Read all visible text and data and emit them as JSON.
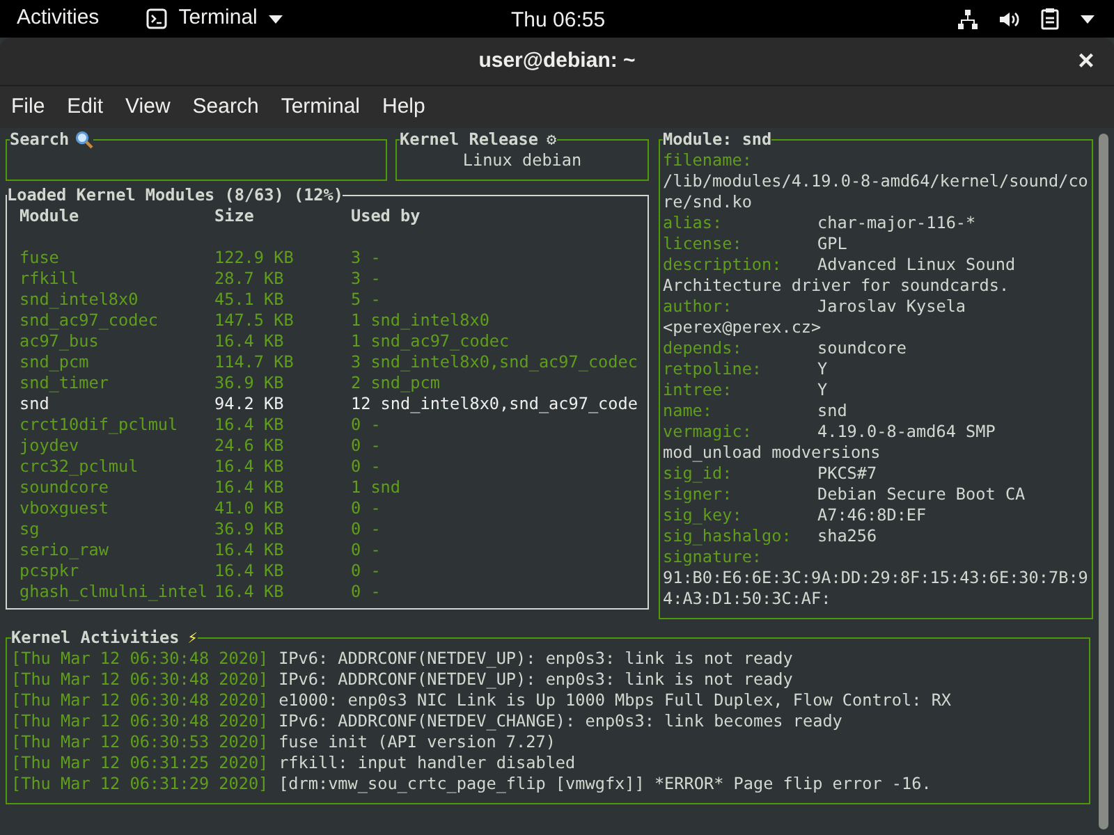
{
  "top_bar": {
    "activities": "Activities",
    "app_menu": "Terminal",
    "clock": "Thu 06:55"
  },
  "window": {
    "title": "user@debian: ~",
    "close": "×"
  },
  "menu": [
    "File",
    "Edit",
    "View",
    "Search",
    "Terminal",
    "Help"
  ],
  "search_panel": {
    "title": "Search",
    "focused": false
  },
  "kernel_release": {
    "title": "Kernel Release",
    "title_icon": "⚙",
    "value": "Linux debian"
  },
  "modules": {
    "title": "Loaded Kernel Modules (8/63) (12%)",
    "focused": true,
    "columns": [
      "Module",
      "Size",
      "Used by"
    ],
    "rows": [
      {
        "name": "fuse",
        "size": "122.9 KB",
        "used_by": "3 -",
        "selected": false
      },
      {
        "name": "rfkill",
        "size": "28.7 KB",
        "used_by": "3 -",
        "selected": false
      },
      {
        "name": "snd_intel8x0",
        "size": "45.1 KB",
        "used_by": "5 -",
        "selected": false
      },
      {
        "name": "snd_ac97_codec",
        "size": "147.5 KB",
        "used_by": "1 snd_intel8x0",
        "selected": false
      },
      {
        "name": "ac97_bus",
        "size": "16.4 KB",
        "used_by": "1 snd_ac97_codec",
        "selected": false
      },
      {
        "name": "snd_pcm",
        "size": "114.7 KB",
        "used_by": "3 snd_intel8x0,snd_ac97_codec",
        "selected": false
      },
      {
        "name": "snd_timer",
        "size": "36.9 KB",
        "used_by": "2 snd_pcm",
        "selected": false
      },
      {
        "name": "snd",
        "size": "94.2 KB",
        "used_by": "12 snd_intel8x0,snd_ac97_code",
        "selected": true
      },
      {
        "name": "crct10dif_pclmul",
        "size": "16.4 KB",
        "used_by": "0 -",
        "selected": false
      },
      {
        "name": "joydev",
        "size": "24.6 KB",
        "used_by": "0 -",
        "selected": false
      },
      {
        "name": "crc32_pclmul",
        "size": "16.4 KB",
        "used_by": "0 -",
        "selected": false
      },
      {
        "name": "soundcore",
        "size": "16.4 KB",
        "used_by": "1 snd",
        "selected": false
      },
      {
        "name": "vboxguest",
        "size": "41.0 KB",
        "used_by": "0 -",
        "selected": false
      },
      {
        "name": "sg",
        "size": "36.9 KB",
        "used_by": "0 -",
        "selected": false
      },
      {
        "name": "serio_raw",
        "size": "16.4 KB",
        "used_by": "0 -",
        "selected": false
      },
      {
        "name": "pcspkr",
        "size": "16.4 KB",
        "used_by": "0 -",
        "selected": false
      },
      {
        "name": "ghash_clmulni_intel",
        "size": "16.4 KB",
        "used_by": "0 -",
        "selected": false
      }
    ]
  },
  "module_info": {
    "title": "Module: snd",
    "focused": false,
    "fields": [
      {
        "label": "filename:",
        "inline": false,
        "value": [
          "/lib/modules/4.19.0-8-amd64/kernel/sound/co",
          "re/snd.ko"
        ]
      },
      {
        "label": "alias:",
        "inline": true,
        "value": [
          "char-major-116-*"
        ]
      },
      {
        "label": "license:",
        "inline": true,
        "value": [
          "GPL"
        ]
      },
      {
        "label": "description:",
        "inline": true,
        "value": [
          "Advanced Linux Sound",
          "Architecture driver for soundcards."
        ]
      },
      {
        "label": "author:",
        "inline": true,
        "value": [
          "Jaroslav Kysela",
          "<perex@perex.cz>"
        ]
      },
      {
        "label": "depends:",
        "inline": true,
        "value": [
          "soundcore"
        ]
      },
      {
        "label": "retpoline:",
        "inline": true,
        "value": [
          "Y"
        ]
      },
      {
        "label": "intree:",
        "inline": true,
        "value": [
          "Y"
        ]
      },
      {
        "label": "name:",
        "inline": true,
        "value": [
          "snd"
        ]
      },
      {
        "label": "vermagic:",
        "inline": true,
        "value": [
          "4.19.0-8-amd64 SMP",
          "mod_unload modversions"
        ]
      },
      {
        "label": "sig_id:",
        "inline": true,
        "value": [
          "PKCS#7"
        ]
      },
      {
        "label": "signer:",
        "inline": true,
        "value": [
          "Debian Secure Boot CA"
        ]
      },
      {
        "label": "sig_key:",
        "inline": true,
        "value": [
          "A7:46:8D:EF"
        ]
      },
      {
        "label": "sig_hashalgo:",
        "inline": true,
        "value": [
          "sha256"
        ]
      },
      {
        "label": "signature:",
        "inline": false,
        "value": [
          "91:B0:E6:6E:3C:9A:DD:29:8F:15:43:6E:30:7B:9",
          "4:A3:D1:50:3C:AF:"
        ]
      }
    ]
  },
  "activities": {
    "title": "Kernel Activities",
    "title_icon": "⚡",
    "focused": false,
    "lines": [
      {
        "time": "[Thu Mar 12 06:30:48 2020]",
        "message": "IPv6: ADDRCONF(NETDEV_UP): enp0s3: link is not ready"
      },
      {
        "time": "[Thu Mar 12 06:30:48 2020]",
        "message": "IPv6: ADDRCONF(NETDEV_UP): enp0s3: link is not ready"
      },
      {
        "time": "[Thu Mar 12 06:30:48 2020]",
        "message": "e1000: enp0s3 NIC Link is Up 1000 Mbps Full Duplex, Flow Control: RX"
      },
      {
        "time": "[Thu Mar 12 06:30:48 2020]",
        "message": "IPv6: ADDRCONF(NETDEV_CHANGE): enp0s3: link becomes ready"
      },
      {
        "time": "[Thu Mar 12 06:30:53 2020]",
        "message": "fuse init (API version 7.27)"
      },
      {
        "time": "[Thu Mar 12 06:31:25 2020]",
        "message": "rfkill: input handler disabled"
      },
      {
        "time": "[Thu Mar 12 06:31:29 2020]",
        "message": "[drm:vmw_sou_crtc_page_flip [vmwgfx]] *ERROR* Page flip error -16."
      }
    ]
  }
}
